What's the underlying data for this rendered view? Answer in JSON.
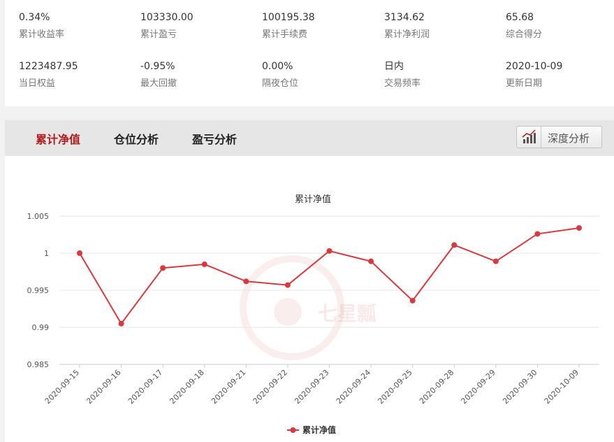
{
  "stats": [
    {
      "value": "0.34%",
      "label": "累计收益率"
    },
    {
      "value": "103330.00",
      "label": "累计盈亏"
    },
    {
      "value": "100195.38",
      "label": "累计手续费"
    },
    {
      "value": "3134.62",
      "label": "累计净利润"
    },
    {
      "value": "65.68",
      "label": "综合得分"
    },
    {
      "value": "1223487.95",
      "label": "当日权益"
    },
    {
      "value": "-0.95%",
      "label": "最大回撤"
    },
    {
      "value": "0.00%",
      "label": "隔夜仓位"
    },
    {
      "value": "日内",
      "label": "交易频率"
    },
    {
      "value": "2020-10-09",
      "label": "更新日期"
    }
  ],
  "tabs": [
    {
      "label": "累计净值",
      "active": true
    },
    {
      "label": "仓位分析",
      "active": false
    },
    {
      "label": "盈亏分析",
      "active": false
    }
  ],
  "deep_analysis": {
    "label": "深度分析",
    "icon": "bar-chart-trend-icon"
  },
  "watermark": {
    "text": "七星瓢"
  },
  "colors": {
    "accent": "#b01c1c",
    "series": "#d9383d",
    "grid": "#e6e6e6"
  },
  "chart_data": {
    "type": "line",
    "title": "累计净值",
    "x": [
      "2020-09-15",
      "2020-09-16",
      "2020-09-17",
      "2020-09-18",
      "2020-09-21",
      "2020-09-22",
      "2020-09-23",
      "2020-09-24",
      "2020-09-25",
      "2020-09-28",
      "2020-09-29",
      "2020-09-30",
      "2020-10-09"
    ],
    "series": [
      {
        "name": "累计净值",
        "values": [
          1.0,
          0.9905,
          0.998,
          0.9985,
          0.9962,
          0.9957,
          1.0003,
          0.9989,
          0.9936,
          1.0011,
          0.9989,
          1.0026,
          1.0034
        ]
      }
    ],
    "yticks": [
      "0.985",
      "0.99",
      "0.995",
      "1",
      "1.005"
    ],
    "ylim": [
      0.985,
      1.005
    ],
    "grid": true,
    "legend": "bottom-center"
  }
}
